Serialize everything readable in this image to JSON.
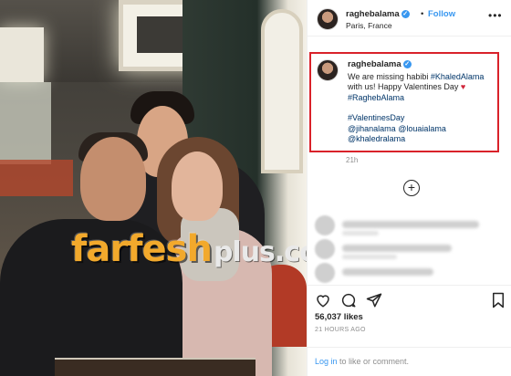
{
  "post": {
    "username": "raghebalama",
    "follow_label": "Follow",
    "separator": "•",
    "location": "Paris, France"
  },
  "caption": {
    "username": "raghebalama",
    "line1": "We are missing habibi ",
    "tag_khaled": "#KhaledAlama",
    "line2": " with us! Happy Valentines Day ",
    "heart": "♥",
    "tag_ragheb": "#RaghebAlama",
    "tag_valentines": "#ValentinesDay",
    "mention_jihan": "@jihanalama",
    "mention_louai": "@louaialama",
    "mention_khaled": "@khaledralama",
    "time": "21h"
  },
  "watermark": {
    "main": "farfesh",
    "suffix": "plus.com"
  },
  "stats": {
    "likes": "56,037 likes",
    "time_ago": "21 HOURS AGO"
  },
  "login": {
    "link": "Log in",
    "rest": " to like or comment."
  },
  "icons": [
    "more-icon",
    "verified-icon",
    "add-comment-icon",
    "heart-icon",
    "comment-icon",
    "share-icon",
    "bookmark-icon"
  ],
  "colors": {
    "link_blue": "#3897f0",
    "hashtag": "#003569",
    "highlight_border": "#d9222a",
    "watermark": "#f2a92c"
  }
}
